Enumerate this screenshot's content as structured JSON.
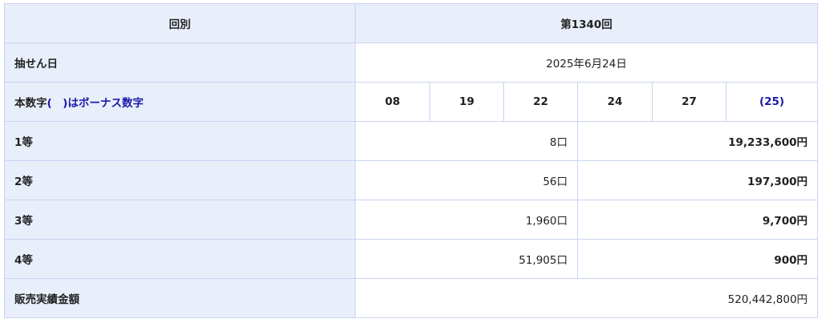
{
  "header": {
    "label": "回別",
    "value": "第1340回"
  },
  "draw_date": {
    "label": "抽せん日",
    "value": "2025年6月24日"
  },
  "numbers": {
    "label_main": "本数字",
    "label_bonus": "(　)はボーナス数字",
    "main": [
      "08",
      "19",
      "22",
      "24",
      "27"
    ],
    "bonus": "(25)"
  },
  "prizes": [
    {
      "rank": "1等",
      "winners": "8口",
      "amount": "19,233,600円"
    },
    {
      "rank": "2等",
      "winners": "56口",
      "amount": "197,300円"
    },
    {
      "rank": "3等",
      "winners": "1,960口",
      "amount": "9,700円"
    },
    {
      "rank": "4等",
      "winners": "51,905口",
      "amount": "900円"
    }
  ],
  "sales": {
    "label": "販売実績金額",
    "value": "520,442,800円"
  },
  "colors": {
    "header_bg": "#e9eefb",
    "border": "#c9d3f2",
    "bonus_text": "#1a1aa6"
  }
}
